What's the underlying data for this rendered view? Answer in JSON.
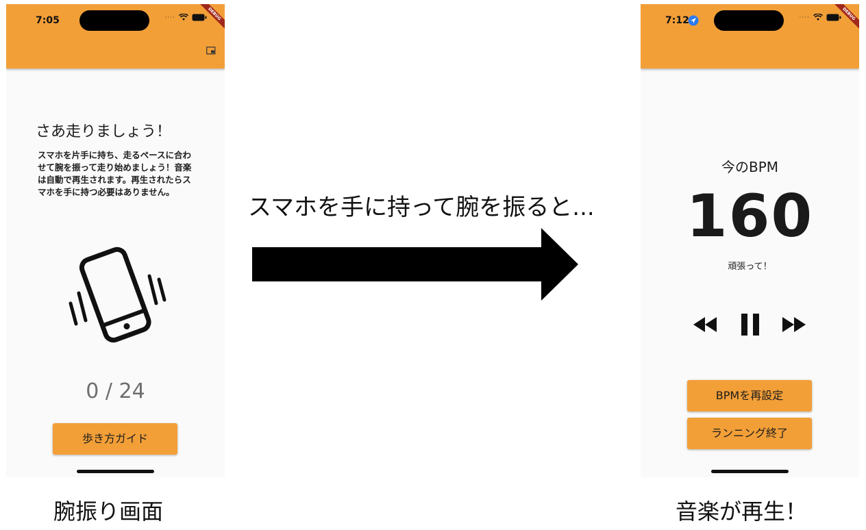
{
  "left_screen": {
    "status_time": "7:05",
    "debug_banner": "DEBUG",
    "title": "さあ走りましょう！",
    "description": "スマホを片手に持ち、走るペースに合わせて腕を振って走り始めましょう！音楽は自動で再生されます。再生されたらスマホを手に持つ必要はありません。",
    "counter": "0 / 24",
    "guide_button": "歩き方ガイド"
  },
  "right_screen": {
    "status_time": "7:12",
    "debug_banner": "DEBUG",
    "bpm_label": "今のBPM",
    "bpm_value": "160",
    "cheer": "頑張って！",
    "reset_button": "BPMを再設定",
    "stop_button": "ランニング終了"
  },
  "middle_text": "スマホを手に持って腕を振ると...",
  "captions": {
    "left": "腕振り画面",
    "right": "音楽が再生！"
  },
  "colors": {
    "accent": "#f29f38",
    "background": "#fafafa",
    "debug_banner": "#a0281c"
  },
  "icons": [
    "picture-in-picture-icon",
    "phone-shake-icon",
    "rewind-icon",
    "pause-icon",
    "fast-forward-icon",
    "wifi-icon",
    "battery-icon",
    "location-icon"
  ]
}
